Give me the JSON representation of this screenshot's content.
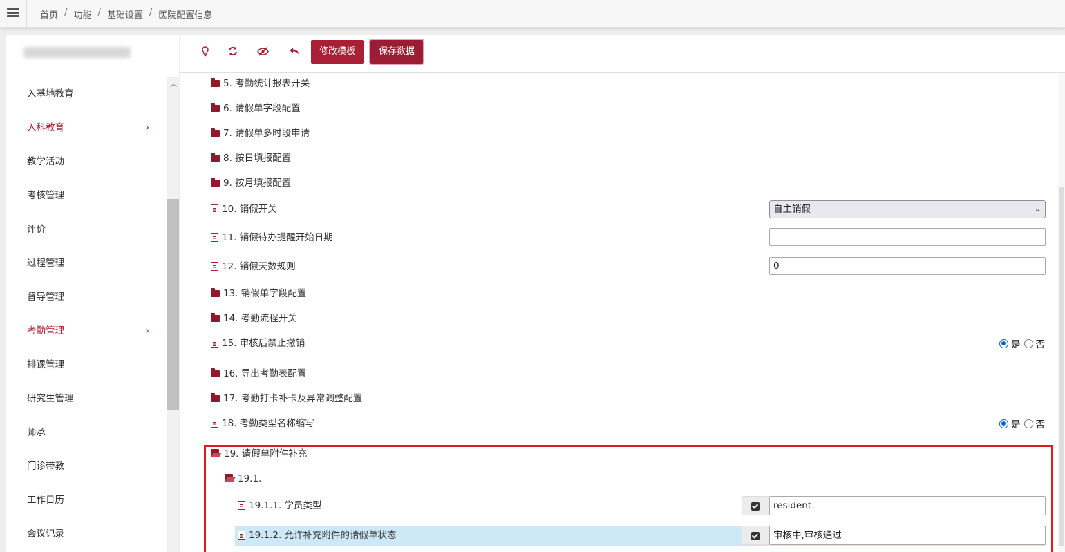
{
  "breadcrumb": [
    "首页",
    "功能",
    "基础设置",
    "医院配置信息"
  ],
  "sidebar": {
    "items": [
      {
        "label": "入基地教育",
        "active": false,
        "chevron": false
      },
      {
        "label": "入科教育",
        "active": true,
        "chevron": true
      },
      {
        "label": "教学活动",
        "active": false,
        "chevron": false
      },
      {
        "label": "考核管理",
        "active": false,
        "chevron": false
      },
      {
        "label": "评价",
        "active": false,
        "chevron": false
      },
      {
        "label": "过程管理",
        "active": false,
        "chevron": false
      },
      {
        "label": "督导管理",
        "active": false,
        "chevron": false
      },
      {
        "label": "考勤管理",
        "active": true,
        "chevron": true
      },
      {
        "label": "排课管理",
        "active": false,
        "chevron": false
      },
      {
        "label": "研究生管理",
        "active": false,
        "chevron": false
      },
      {
        "label": "师承",
        "active": false,
        "chevron": false
      },
      {
        "label": "门诊带教",
        "active": false,
        "chevron": false
      },
      {
        "label": "工作日历",
        "active": false,
        "chevron": false
      },
      {
        "label": "会议记录",
        "active": false,
        "chevron": false
      }
    ],
    "chevron_glyph": "›"
  },
  "toolbar": {
    "icons": [
      "lightbulb-icon",
      "refresh-icon",
      "eye-slash-icon",
      "undo-icon"
    ],
    "edit_template_label": "修改模板",
    "save_data_label": "保存数据"
  },
  "tree": {
    "r5": "5. 考勤统计报表开关",
    "r6": "6. 请假单字段配置",
    "r7": "7. 请假单多时段申请",
    "r8": "8. 按日填报配置",
    "r9": "9. 按月填报配置",
    "r10": "10. 销假开关",
    "r11": "11. 销假待办提醒开始日期",
    "r12": "12. 销假天数规则",
    "r13": "13. 销假单字段配置",
    "r14": "14. 考勤流程开关",
    "r15": "15. 审核后禁止撤销",
    "r16": "16. 导出考勤表配置",
    "r17": "17. 考勤打卡补卡及异常调整配置",
    "r18": "18. 考勤类型名称缩写",
    "r19": "19. 请假单附件补充",
    "r19_1": "19.1.",
    "r19_1_1": "19.1.1. 学员类型",
    "r19_1_2": "19.1.2. 允许补充附件的请假单状态"
  },
  "fields": {
    "leave_cancel_switch": "自主销假",
    "reminder_start_date": "",
    "leave_days_rule": "0",
    "student_type": "resident",
    "allowed_status": "审核中,审核通过"
  },
  "radio": {
    "yes": "是",
    "no": "否",
    "r15_selected": "是",
    "r18_selected": "是"
  },
  "colors": {
    "accent": "#a81f36",
    "highlight_border": "#e01b1b",
    "selected_row": "#cde8f6"
  }
}
